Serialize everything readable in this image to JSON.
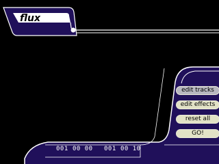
{
  "app": {
    "title": "flux"
  },
  "menu": {
    "items": [
      {
        "label": "edit tracks",
        "state": "selected"
      },
      {
        "label": "edit effects",
        "state": "normal"
      },
      {
        "label": "reset all",
        "state": "normal"
      },
      {
        "label": "GO!",
        "state": "normal"
      }
    ]
  },
  "transport": {
    "counters": [
      {
        "track": "001",
        "time": "00 00"
      },
      {
        "track": "001",
        "time": "00 10"
      }
    ]
  },
  "colors": {
    "background": "#000000",
    "panel": "#20105a",
    "outline": "#ffffff",
    "title_plate": "#ffffff",
    "button_active": "#b8b8c0",
    "button_normal": "#e2e2c6"
  }
}
